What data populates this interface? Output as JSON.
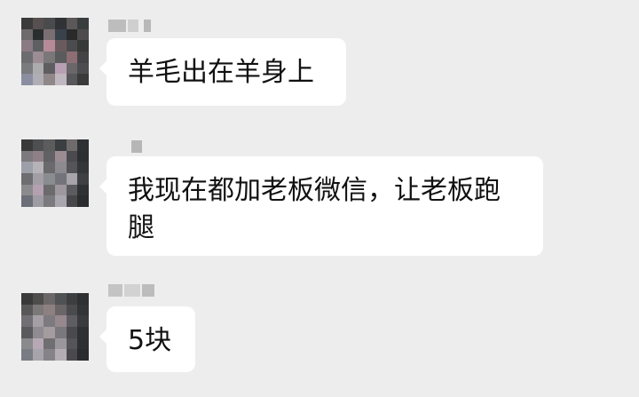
{
  "messages": [
    {
      "text": "羊毛出在羊身上"
    },
    {
      "text": "我现在都加老板微信，让老板跑腿"
    },
    {
      "text": "5块"
    }
  ]
}
